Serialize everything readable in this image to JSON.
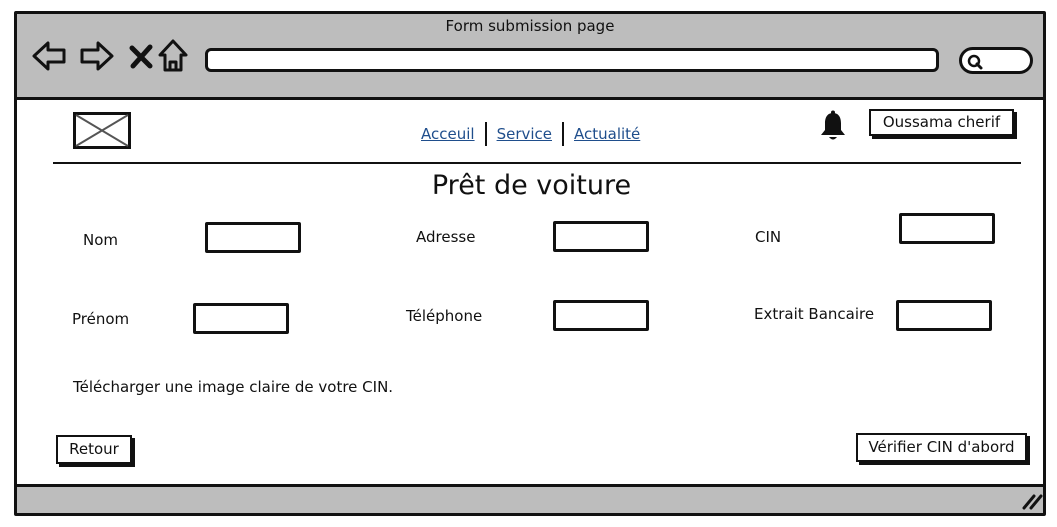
{
  "window": {
    "title": "Form submission page"
  },
  "nav": {
    "links": [
      "Acceuil",
      "Service",
      "Actualité"
    ]
  },
  "user": {
    "name": "Oussama cherif"
  },
  "form": {
    "title": "Prêt de voiture",
    "fields": {
      "nom": "Nom",
      "adresse": "Adresse",
      "cin": "CIN",
      "prenom": "Prénom",
      "telephone": "Téléphone",
      "extrait": "Extrait Bancaire"
    },
    "hint": "Télécharger une image claire de votre CIN.",
    "back_label": "Retour",
    "verify_label": "Vérifier CIN d'abord"
  }
}
